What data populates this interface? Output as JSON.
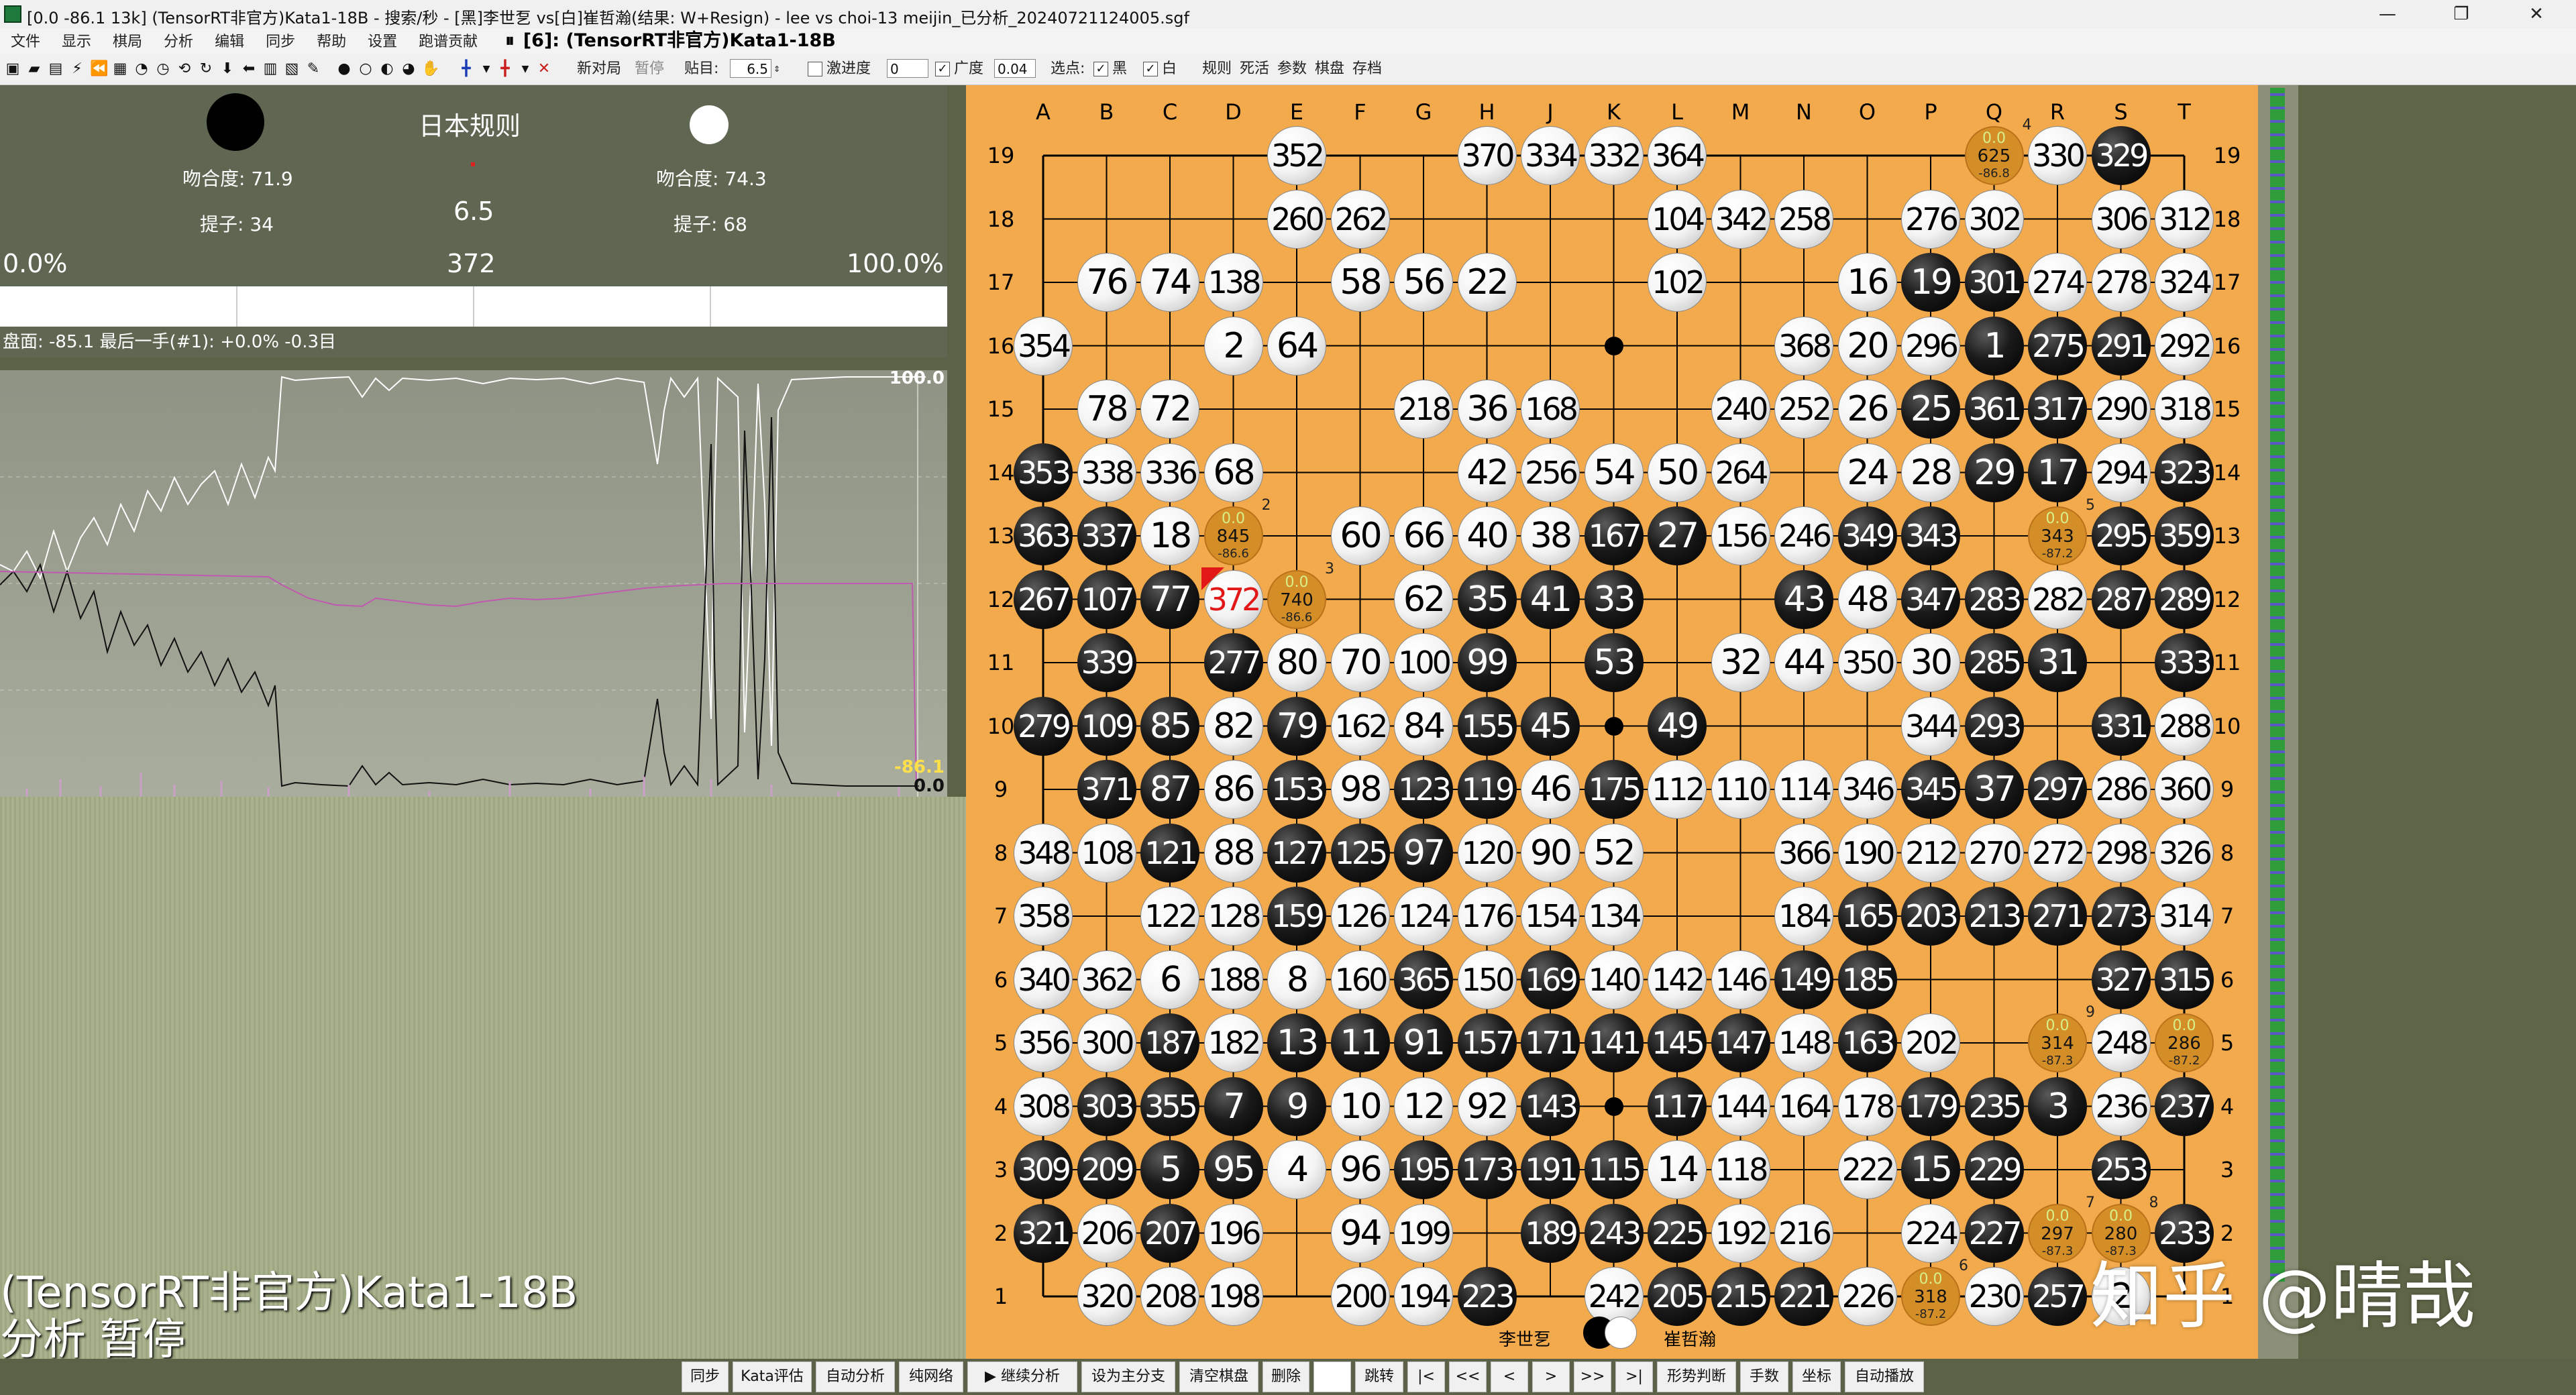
{
  "window": {
    "title": "[0.0 -86.1 13k] (TensorRT非官方)Kata1-18B - 搜索/秒 - [黑]李世乭 vs[白]崔哲瀚(结果: W+Resign) - lee vs choi-13 meijin_已分析_20240721124005.sgf",
    "controls": [
      "—",
      "❐",
      "✕"
    ]
  },
  "menu": {
    "items": [
      "文件",
      "显示",
      "棋局",
      "分析",
      "编辑",
      "同步",
      "帮助",
      "设置",
      "跑谱贡献"
    ],
    "pause_glyph": "⏸",
    "engine_status": "[6]: (TensorRT非官方)Kata1-18B"
  },
  "toolbar": {
    "new_game": "新对局",
    "pause": "暂停",
    "komi_label": "贴目:",
    "komi_value": "6.5",
    "aggressive_label": "激进度",
    "aggressive_value": "0",
    "width_label": "广度",
    "width_value": "0.04",
    "pick_label": "选点:",
    "black_label": "黑",
    "white_label": "白",
    "rules_label": "规则",
    "deadstones_label": "死活",
    "params_label": "参数",
    "board_label": "棋盘",
    "save_label": "存档"
  },
  "info": {
    "ruleset": "日本规则",
    "black_match": "吻合度: 71.9",
    "white_match": "吻合度: 74.3",
    "black_captures": "提子: 34",
    "white_captures": "提子: 68",
    "komi": "6.5",
    "left_pct": "0.0%",
    "move_number": "372",
    "right_pct": "100.0%",
    "black_win_fraction": 0.0
  },
  "status_line": "盘面: -85.1 最后一手(#1): +0.0% -0.3目",
  "graph": {
    "top_label": "100.0",
    "score_label": "-86.1",
    "win_label": "0.0"
  },
  "engine_overlay": {
    "name": "(TensorRT非官方)Kata1-18B",
    "state": "分析 暂停"
  },
  "board": {
    "columns": [
      "A",
      "B",
      "C",
      "D",
      "E",
      "F",
      "G",
      "H",
      "J",
      "K",
      "L",
      "M",
      "N",
      "O",
      "P",
      "Q",
      "R",
      "S",
      "T"
    ],
    "rows": [
      "19",
      "18",
      "17",
      "16",
      "15",
      "14",
      "13",
      "12",
      "11",
      "10",
      "9",
      "8",
      "7",
      "6",
      "5",
      "4",
      "3",
      "2",
      "1"
    ],
    "stones": [
      [
        "E19",
        "w",
        "352"
      ],
      [
        "H19",
        "w",
        "370"
      ],
      [
        "J19",
        "w",
        "334"
      ],
      [
        "K19",
        "w",
        "332"
      ],
      [
        "L19",
        "w",
        "364"
      ],
      [
        "R19",
        "w",
        "330"
      ],
      [
        "S19",
        "b",
        "329"
      ],
      [
        "E18",
        "w",
        "260"
      ],
      [
        "F18",
        "w",
        "262"
      ],
      [
        "L18",
        "w",
        "104"
      ],
      [
        "M18",
        "w",
        "342"
      ],
      [
        "N18",
        "w",
        "258"
      ],
      [
        "P18",
        "w",
        "276"
      ],
      [
        "Q18",
        "w",
        "302"
      ],
      [
        "S18",
        "w",
        "306"
      ],
      [
        "T18",
        "w",
        "312"
      ],
      [
        "B17",
        "w",
        "76"
      ],
      [
        "C17",
        "w",
        "74"
      ],
      [
        "D17",
        "w",
        "138"
      ],
      [
        "F17",
        "w",
        "58"
      ],
      [
        "G17",
        "w",
        "56"
      ],
      [
        "H17",
        "w",
        "22"
      ],
      [
        "L17",
        "w",
        "102"
      ],
      [
        "O17",
        "w",
        "16"
      ],
      [
        "P17",
        "b",
        "19"
      ],
      [
        "Q17",
        "b",
        "301"
      ],
      [
        "R17",
        "w",
        "274"
      ],
      [
        "S17",
        "w",
        "278"
      ],
      [
        "T17",
        "w",
        "324"
      ],
      [
        "A16",
        "w",
        "354"
      ],
      [
        "D16",
        "w",
        "2"
      ],
      [
        "E16",
        "w",
        "64"
      ],
      [
        "N16",
        "w",
        "368"
      ],
      [
        "O16",
        "w",
        "20"
      ],
      [
        "P16",
        "w",
        "296"
      ],
      [
        "Q16",
        "b",
        "1"
      ],
      [
        "R16",
        "b",
        "275"
      ],
      [
        "S16",
        "b",
        "291"
      ],
      [
        "T16",
        "w",
        "292"
      ],
      [
        "B15",
        "w",
        "78"
      ],
      [
        "C15",
        "w",
        "72"
      ],
      [
        "G15",
        "w",
        "218"
      ],
      [
        "H15",
        "w",
        "36"
      ],
      [
        "J15",
        "w",
        "168"
      ],
      [
        "M15",
        "w",
        "240"
      ],
      [
        "N15",
        "w",
        "252"
      ],
      [
        "O15",
        "w",
        "26"
      ],
      [
        "P15",
        "b",
        "25"
      ],
      [
        "Q15",
        "b",
        "361"
      ],
      [
        "R15",
        "b",
        "317"
      ],
      [
        "S15",
        "w",
        "290"
      ],
      [
        "T15",
        "w",
        "318"
      ],
      [
        "A14",
        "b",
        "353"
      ],
      [
        "B14",
        "w",
        "338"
      ],
      [
        "C14",
        "w",
        "336"
      ],
      [
        "D14",
        "w",
        "68"
      ],
      [
        "H14",
        "w",
        "42"
      ],
      [
        "J14",
        "w",
        "256"
      ],
      [
        "K14",
        "w",
        "54"
      ],
      [
        "L14",
        "w",
        "50"
      ],
      [
        "M14",
        "w",
        "264"
      ],
      [
        "O14",
        "w",
        "24"
      ],
      [
        "P14",
        "w",
        "28"
      ],
      [
        "Q14",
        "b",
        "29"
      ],
      [
        "R14",
        "b",
        "17"
      ],
      [
        "S14",
        "w",
        "294"
      ],
      [
        "T14",
        "b",
        "323"
      ],
      [
        "A13",
        "b",
        "363"
      ],
      [
        "B13",
        "b",
        "337"
      ],
      [
        "C13",
        "w",
        "18"
      ],
      [
        "F13",
        "w",
        "60"
      ],
      [
        "G13",
        "w",
        "66"
      ],
      [
        "H13",
        "w",
        "40"
      ],
      [
        "J13",
        "w",
        "38"
      ],
      [
        "K13",
        "b",
        "167"
      ],
      [
        "L13",
        "b",
        "27"
      ],
      [
        "M13",
        "w",
        "156"
      ],
      [
        "N13",
        "w",
        "246"
      ],
      [
        "O13",
        "b",
        "349"
      ],
      [
        "P13",
        "b",
        "343"
      ],
      [
        "S13",
        "b",
        "295"
      ],
      [
        "T13",
        "b",
        "359"
      ],
      [
        "A12",
        "b",
        "267"
      ],
      [
        "B12",
        "b",
        "107"
      ],
      [
        "C12",
        "b",
        "77"
      ],
      [
        "D12",
        "w",
        "372"
      ],
      [
        "G12",
        "w",
        "62"
      ],
      [
        "H12",
        "b",
        "35"
      ],
      [
        "J12",
        "b",
        "41"
      ],
      [
        "K12",
        "b",
        "33"
      ],
      [
        "N12",
        "b",
        "43"
      ],
      [
        "O12",
        "w",
        "48"
      ],
      [
        "P12",
        "b",
        "347"
      ],
      [
        "Q12",
        "b",
        "283"
      ],
      [
        "R12",
        "w",
        "282"
      ],
      [
        "S12",
        "b",
        "287"
      ],
      [
        "T12",
        "b",
        "289"
      ],
      [
        "B11",
        "b",
        "339"
      ],
      [
        "D11",
        "b",
        "277"
      ],
      [
        "E11",
        "w",
        "80"
      ],
      [
        "F11",
        "w",
        "70"
      ],
      [
        "G11",
        "w",
        "100"
      ],
      [
        "H11",
        "b",
        "99"
      ],
      [
        "K11",
        "b",
        "53"
      ],
      [
        "M11",
        "w",
        "32"
      ],
      [
        "N11",
        "w",
        "44"
      ],
      [
        "O11",
        "w",
        "350"
      ],
      [
        "P11",
        "w",
        "30"
      ],
      [
        "Q11",
        "b",
        "285"
      ],
      [
        "R11",
        "b",
        "31"
      ],
      [
        "T11",
        "b",
        "333"
      ],
      [
        "A10",
        "b",
        "279"
      ],
      [
        "B10",
        "b",
        "109"
      ],
      [
        "C10",
        "b",
        "85"
      ],
      [
        "D10",
        "w",
        "82"
      ],
      [
        "E10",
        "b",
        "79"
      ],
      [
        "F10",
        "w",
        "162"
      ],
      [
        "G10",
        "w",
        "84"
      ],
      [
        "H10",
        "b",
        "155"
      ],
      [
        "J10",
        "b",
        "45"
      ],
      [
        "L10",
        "b",
        "49"
      ],
      [
        "P10",
        "w",
        "344"
      ],
      [
        "Q10",
        "b",
        "293"
      ],
      [
        "S10",
        "b",
        "331"
      ],
      [
        "T10",
        "w",
        "288"
      ],
      [
        "B9",
        "b",
        "371"
      ],
      [
        "C9",
        "b",
        "87"
      ],
      [
        "D9",
        "w",
        "86"
      ],
      [
        "E9",
        "b",
        "153"
      ],
      [
        "F9",
        "w",
        "98"
      ],
      [
        "G9",
        "b",
        "123"
      ],
      [
        "H9",
        "b",
        "119"
      ],
      [
        "J9",
        "w",
        "46"
      ],
      [
        "K9",
        "b",
        "175"
      ],
      [
        "L9",
        "w",
        "112"
      ],
      [
        "M9",
        "w",
        "110"
      ],
      [
        "N9",
        "w",
        "114"
      ],
      [
        "O9",
        "w",
        "346"
      ],
      [
        "P9",
        "b",
        "345"
      ],
      [
        "Q9",
        "b",
        "37"
      ],
      [
        "R9",
        "b",
        "297"
      ],
      [
        "S9",
        "w",
        "286"
      ],
      [
        "T9",
        "w",
        "360"
      ],
      [
        "A8",
        "w",
        "348"
      ],
      [
        "B8",
        "w",
        "108"
      ],
      [
        "C8",
        "b",
        "121"
      ],
      [
        "D8",
        "w",
        "88"
      ],
      [
        "E8",
        "b",
        "127"
      ],
      [
        "F8",
        "b",
        "125"
      ],
      [
        "G8",
        "b",
        "97"
      ],
      [
        "H8",
        "w",
        "120"
      ],
      [
        "J8",
        "w",
        "90"
      ],
      [
        "K8",
        "w",
        "52"
      ],
      [
        "N8",
        "w",
        "366"
      ],
      [
        "O8",
        "w",
        "190"
      ],
      [
        "P8",
        "w",
        "212"
      ],
      [
        "Q8",
        "w",
        "270"
      ],
      [
        "R8",
        "w",
        "272"
      ],
      [
        "S8",
        "w",
        "298"
      ],
      [
        "T8",
        "w",
        "326"
      ],
      [
        "A7",
        "w",
        "358"
      ],
      [
        "C7",
        "w",
        "122"
      ],
      [
        "D7",
        "w",
        "128"
      ],
      [
        "E7",
        "b",
        "159"
      ],
      [
        "F7",
        "w",
        "126"
      ],
      [
        "G7",
        "w",
        "124"
      ],
      [
        "H7",
        "w",
        "176"
      ],
      [
        "J7",
        "w",
        "154"
      ],
      [
        "K7",
        "w",
        "134"
      ],
      [
        "N7",
        "w",
        "184"
      ],
      [
        "O7",
        "b",
        "165"
      ],
      [
        "P7",
        "b",
        "203"
      ],
      [
        "Q7",
        "b",
        "213"
      ],
      [
        "R7",
        "b",
        "271"
      ],
      [
        "S7",
        "b",
        "273"
      ],
      [
        "T7",
        "w",
        "314"
      ],
      [
        "A6",
        "w",
        "340"
      ],
      [
        "B6",
        "w",
        "362"
      ],
      [
        "C6",
        "w",
        "6"
      ],
      [
        "D6",
        "w",
        "188"
      ],
      [
        "E6",
        "w",
        "8"
      ],
      [
        "F6",
        "w",
        "160"
      ],
      [
        "G6",
        "b",
        "365"
      ],
      [
        "H6",
        "w",
        "150"
      ],
      [
        "J6",
        "b",
        "169"
      ],
      [
        "K6",
        "w",
        "140"
      ],
      [
        "L6",
        "w",
        "142"
      ],
      [
        "M6",
        "w",
        "146"
      ],
      [
        "N6",
        "b",
        "149"
      ],
      [
        "O6",
        "b",
        "185"
      ],
      [
        "S6",
        "b",
        "327"
      ],
      [
        "T6",
        "b",
        "315"
      ],
      [
        "A5",
        "w",
        "356"
      ],
      [
        "B5",
        "w",
        "300"
      ],
      [
        "C5",
        "b",
        "187"
      ],
      [
        "D5",
        "w",
        "182"
      ],
      [
        "E5",
        "b",
        "13"
      ],
      [
        "F5",
        "b",
        "11"
      ],
      [
        "G5",
        "b",
        "91"
      ],
      [
        "H5",
        "b",
        "157"
      ],
      [
        "J5",
        "b",
        "171"
      ],
      [
        "K5",
        "b",
        "141"
      ],
      [
        "L5",
        "b",
        "145"
      ],
      [
        "M5",
        "b",
        "147"
      ],
      [
        "N5",
        "w",
        "148"
      ],
      [
        "O5",
        "b",
        "163"
      ],
      [
        "P5",
        "w",
        "202"
      ],
      [
        "S5",
        "w",
        "248"
      ],
      [
        "A4",
        "w",
        "308"
      ],
      [
        "B4",
        "b",
        "303"
      ],
      [
        "C4",
        "b",
        "355"
      ],
      [
        "D4",
        "b",
        "7"
      ],
      [
        "E4",
        "b",
        "9"
      ],
      [
        "F4",
        "w",
        "10"
      ],
      [
        "G4",
        "w",
        "12"
      ],
      [
        "H4",
        "w",
        "92"
      ],
      [
        "J4",
        "b",
        "143"
      ],
      [
        "L4",
        "b",
        "117"
      ],
      [
        "M4",
        "w",
        "144"
      ],
      [
        "N4",
        "w",
        "164"
      ],
      [
        "O4",
        "w",
        "178"
      ],
      [
        "P4",
        "b",
        "179"
      ],
      [
        "Q4",
        "b",
        "235"
      ],
      [
        "R4",
        "b",
        "3"
      ],
      [
        "S4",
        "w",
        "236"
      ],
      [
        "T4",
        "b",
        "237"
      ],
      [
        "A3",
        "b",
        "309"
      ],
      [
        "B3",
        "b",
        "209"
      ],
      [
        "C3",
        "b",
        "5"
      ],
      [
        "D3",
        "b",
        "95"
      ],
      [
        "E3",
        "w",
        "4"
      ],
      [
        "F3",
        "w",
        "96"
      ],
      [
        "G3",
        "b",
        "195"
      ],
      [
        "H3",
        "b",
        "173"
      ],
      [
        "J3",
        "b",
        "191"
      ],
      [
        "K3",
        "b",
        "115"
      ],
      [
        "L3",
        "w",
        "14"
      ],
      [
        "M3",
        "w",
        "118"
      ],
      [
        "O3",
        "w",
        "222"
      ],
      [
        "P3",
        "b",
        "15"
      ],
      [
        "Q3",
        "b",
        "229"
      ],
      [
        "S3",
        "b",
        "253"
      ],
      [
        "A2",
        "b",
        "321"
      ],
      [
        "B2",
        "w",
        "206"
      ],
      [
        "C2",
        "b",
        "207"
      ],
      [
        "D2",
        "w",
        "196"
      ],
      [
        "F2",
        "w",
        "94"
      ],
      [
        "G2",
        "w",
        "199"
      ],
      [
        "J2",
        "b",
        "189"
      ],
      [
        "K2",
        "b",
        "243"
      ],
      [
        "L2",
        "b",
        "225"
      ],
      [
        "M2",
        "w",
        "192"
      ],
      [
        "N2",
        "w",
        "216"
      ],
      [
        "P2",
        "w",
        "224"
      ],
      [
        "Q2",
        "b",
        "227"
      ],
      [
        "T2",
        "b",
        "233"
      ],
      [
        "B1",
        "w",
        "320"
      ],
      [
        "C1",
        "w",
        "208"
      ],
      [
        "D1",
        "w",
        "198"
      ],
      [
        "F1",
        "w",
        "200"
      ],
      [
        "G1",
        "w",
        "194"
      ],
      [
        "H1",
        "b",
        "223"
      ],
      [
        "K1",
        "w",
        "242"
      ],
      [
        "L1",
        "b",
        "205"
      ],
      [
        "M1",
        "b",
        "215"
      ],
      [
        "N1",
        "b",
        "221"
      ],
      [
        "O1",
        "w",
        "226"
      ],
      [
        "Q1",
        "w",
        "230"
      ],
      [
        "R1",
        "b",
        "257"
      ],
      [
        "S1",
        "w",
        "2"
      ]
    ],
    "last_move": "D12",
    "hoshi": [
      "K16",
      "K10",
      "K4"
    ],
    "candidates": [
      {
        "pt": "Q19",
        "winrate": "0.0",
        "visits": "625",
        "score": "-86.8",
        "rank": "4"
      },
      {
        "pt": "D13",
        "winrate": "0.0",
        "visits": "845",
        "score": "-86.6",
        "rank": "2"
      },
      {
        "pt": "E12",
        "winrate": "0.0",
        "visits": "740",
        "score": "-86.6",
        "rank": "3"
      },
      {
        "pt": "R13",
        "winrate": "0.0",
        "visits": "343",
        "score": "-87.2",
        "rank": "5"
      },
      {
        "pt": "R5",
        "winrate": "0.0",
        "visits": "314",
        "score": "-87.3",
        "rank": "9"
      },
      {
        "pt": "T5",
        "winrate": "0.0",
        "visits": "286",
        "score": "-87.2",
        "rank": ""
      },
      {
        "pt": "R2",
        "winrate": "0.0",
        "visits": "297",
        "score": "-87.3",
        "rank": "7"
      },
      {
        "pt": "S2",
        "winrate": "0.0",
        "visits": "280",
        "score": "-87.3",
        "rank": "8"
      },
      {
        "pt": "P1",
        "winrate": "0.0",
        "visits": "318",
        "score": "-87.2",
        "rank": "6"
      }
    ],
    "black_player": "李世乭",
    "white_player": "崔哲瀚"
  },
  "watermark": "知乎 @晴哉",
  "bottom_buttons": [
    "同步",
    "Kata评估",
    "自动分析",
    "纯网络",
    "▶ 继续分析",
    "设为主分支",
    "清空棋盘",
    "删除",
    "",
    "跳转",
    "|<",
    "<<",
    "<",
    ">",
    ">>",
    ">|",
    "形势判断",
    "手数",
    "坐标",
    "自动播放"
  ],
  "colors": {
    "board": "#f2aa4c",
    "panel": "#5f6651",
    "black_curve": "#111111",
    "white_curve": "#ffffff",
    "score_curve": "#c05ab0"
  }
}
